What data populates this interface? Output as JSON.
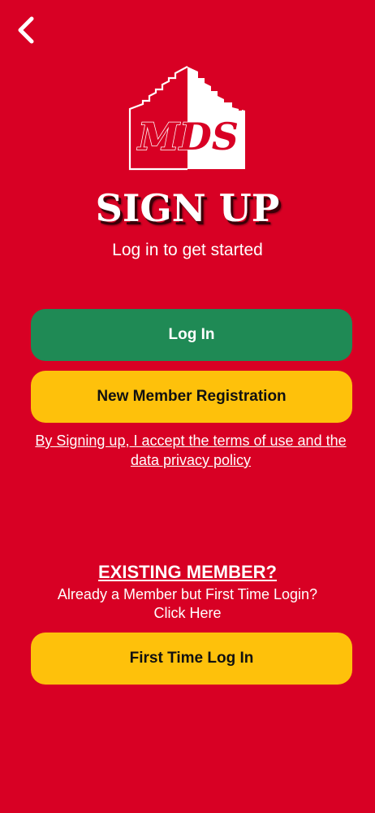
{
  "logo": {
    "text": "MDS"
  },
  "header": {
    "title": "SIGN UP",
    "subtitle": "Log in to get started"
  },
  "buttons": {
    "login_label": "Log In",
    "register_label": "New Member Registration",
    "first_time_label": "First Time Log In"
  },
  "terms": {
    "text": "By Signing up, I accept the terms of use and the data privacy policy"
  },
  "existing": {
    "title": "EXISTING MEMBER?",
    "line1": "Already a Member but First Time Login?",
    "click_here": "Click Here"
  },
  "colors": {
    "background": "#d80024",
    "login_button": "#1f8a55",
    "yellow_button": "#fec10b"
  },
  "icons": {
    "back": "chevron-left-icon"
  }
}
